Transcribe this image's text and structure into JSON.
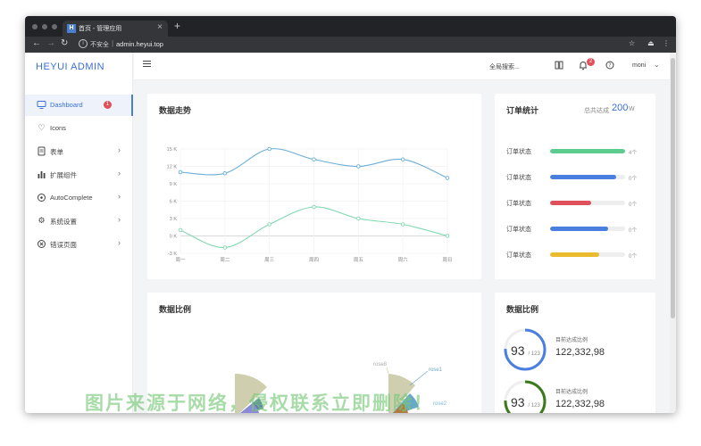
{
  "browser": {
    "tab_title": "首页 - 管理应用",
    "tab_logo": "H",
    "new_tab": "+",
    "tab_close": "×",
    "insecure_label": "不安全",
    "separator": "|",
    "url": "admin.heyui.top",
    "icons": [
      "back-icon",
      "forward-icon",
      "reload-icon",
      "info-icon",
      "star-icon",
      "extension-icon",
      "more-vertical-icon"
    ]
  },
  "sidebar": {
    "logo": "HEYUI ADMIN",
    "items": [
      {
        "label": "Dashboard",
        "icon": "monitor-icon",
        "badge": "1",
        "active": true
      },
      {
        "label": "Icons",
        "icon": "heart-icon"
      },
      {
        "label": "表单",
        "icon": "document-icon",
        "chevron": true
      },
      {
        "label": "扩展组件",
        "icon": "bar-chart-icon",
        "chevron": true
      },
      {
        "label": "AutoComplete",
        "icon": "target-icon",
        "chevron": true
      },
      {
        "label": "系统设置",
        "icon": "gear-icon",
        "chevron": true
      },
      {
        "label": "错误页面",
        "icon": "close-circle-icon",
        "chevron": true
      }
    ]
  },
  "header": {
    "search_label": "全局搜索...",
    "notification_badge": "2",
    "user_name": "moni"
  },
  "trend_card": {
    "title": "数据走势"
  },
  "orders_card": {
    "title": "订单统计",
    "total_label": "总共达成",
    "total_value": "200",
    "total_unit": "W",
    "rows": [
      {
        "label": "订单状态",
        "progress": 1.0,
        "color": "#5ccb8e",
        "count": "4个"
      },
      {
        "label": "订单状态",
        "progress": 0.88,
        "color": "#4a7fe0",
        "count": "0个"
      },
      {
        "label": "订单状态",
        "progress": 0.55,
        "color": "#e0505a",
        "count": "0个"
      },
      {
        "label": "订单状态",
        "progress": 0.77,
        "color": "#4a7fe0",
        "count": "0个"
      },
      {
        "label": "订单状态",
        "progress": 0.66,
        "color": "#eabb2d",
        "count": "0个"
      }
    ]
  },
  "ratio_card": {
    "title": "数据比例",
    "legend_rose1": "rose1",
    "legend_rose2": "rose2",
    "legend_rose8": "rose8"
  },
  "ratio_card_2": {
    "title": "数据比例",
    "rings": [
      {
        "value": "93",
        "total": "/ 123",
        "label": "目前达成比例",
        "amount": "122,332,98",
        "fraction": 0.756,
        "color": "#4a7fe0"
      },
      {
        "value": "93",
        "total": "/ 123",
        "label": "目前达成比例",
        "amount": "122,332,98",
        "fraction": 0.756,
        "color": "#3a7a1a"
      }
    ]
  },
  "watermark": "图片来源于网络，侵权联系立即删除！",
  "chart_data": {
    "type": "line",
    "title": "数据走势",
    "categories": [
      "周一",
      "周二",
      "周三",
      "周四",
      "周五",
      "周六",
      "周日"
    ],
    "series": [
      {
        "values": [
          11,
          10.8,
          15,
          13.2,
          12,
          13.2,
          10
        ]
      },
      {
        "values": [
          1,
          -2,
          2,
          5,
          3,
          2,
          0
        ]
      }
    ],
    "y_ticks": [
      "15 K",
      "12 K",
      "9 K",
      "6 K",
      "3 K",
      "0 K",
      "-3 K"
    ],
    "ylim": [
      -3,
      15
    ],
    "grid": true,
    "colors": [
      "#6baed6",
      "#80d8b0"
    ]
  }
}
